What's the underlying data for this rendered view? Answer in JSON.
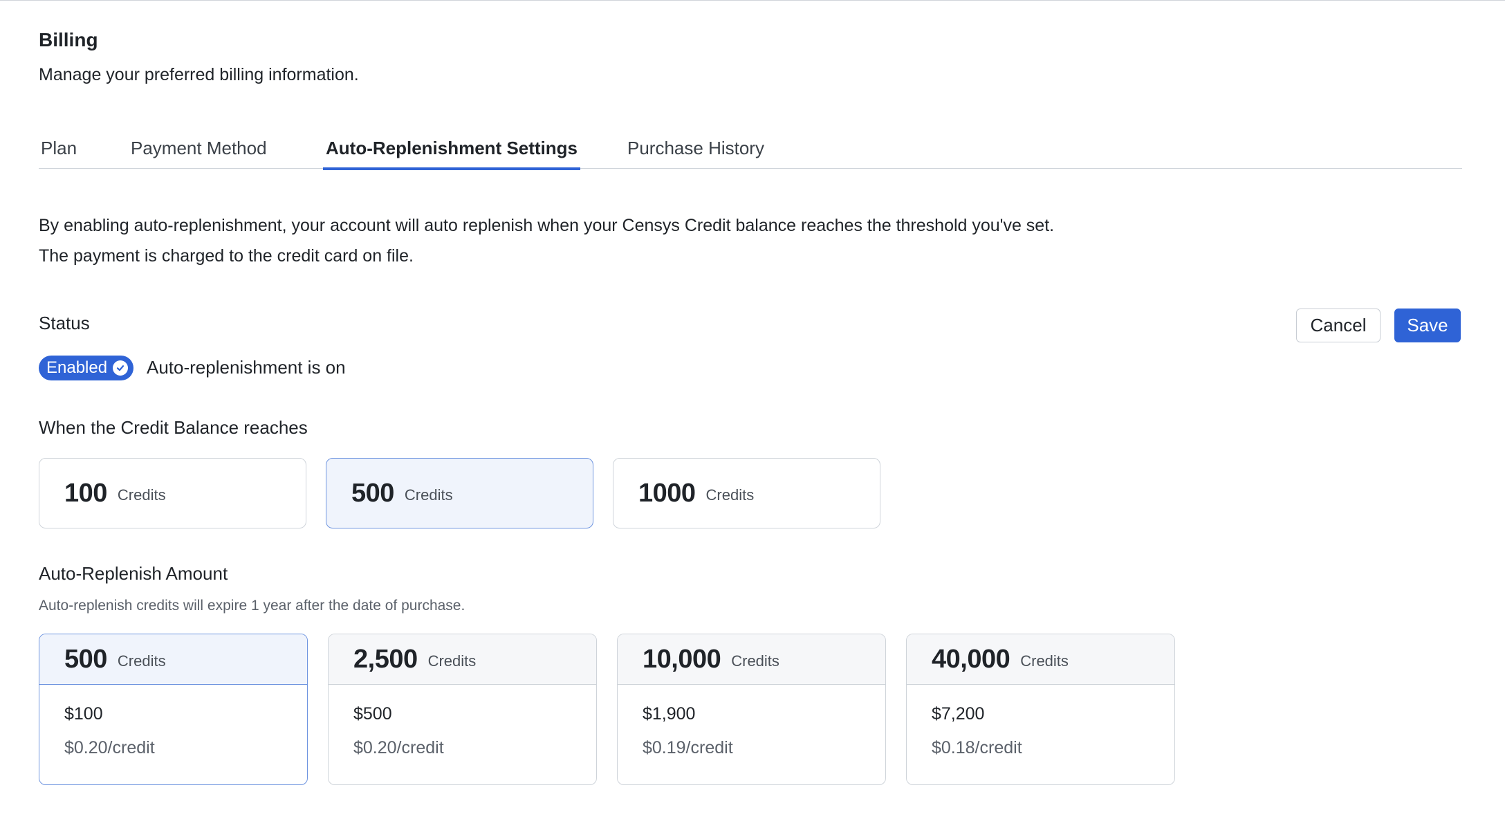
{
  "header": {
    "title": "Billing",
    "subtitle": "Manage your preferred billing information."
  },
  "tabs": [
    {
      "label": "Plan"
    },
    {
      "label": "Payment Method"
    },
    {
      "label": "Auto-Replenishment Settings",
      "active": true
    },
    {
      "label": "Purchase History"
    }
  ],
  "description": {
    "line1": "By enabling auto-replenishment, your account will auto replenish when your Censys Credit balance reaches the threshold you've set.",
    "line2": "The payment is charged to the credit card on file."
  },
  "status": {
    "label": "Status",
    "badge": "Enabled",
    "badge_icon": "check-circle-icon",
    "text": "Auto-replenishment is on"
  },
  "actions": {
    "cancel_label": "Cancel",
    "save_label": "Save"
  },
  "threshold": {
    "label": "When the Credit Balance reaches",
    "selected_index": 1,
    "options": [
      {
        "value": "100",
        "unit": "Credits"
      },
      {
        "value": "500",
        "unit": "Credits"
      },
      {
        "value": "1000",
        "unit": "Credits"
      }
    ]
  },
  "amount": {
    "label": "Auto-Replenish Amount",
    "note": "Auto-replenish credits will expire 1 year after the date of purchase.",
    "selected_index": 0,
    "options": [
      {
        "credits": "500",
        "unit": "Credits",
        "price": "$100",
        "per_credit": "$0.20/credit"
      },
      {
        "credits": "2,500",
        "unit": "Credits",
        "price": "$500",
        "per_credit": "$0.20/credit"
      },
      {
        "credits": "10,000",
        "unit": "Credits",
        "price": "$1,900",
        "per_credit": "$0.19/credit"
      },
      {
        "credits": "40,000",
        "unit": "Credits",
        "price": "$7,200",
        "per_credit": "$0.18/credit"
      }
    ]
  },
  "colors": {
    "accent": "#2f63d6",
    "selected_bg": "#f0f4fc",
    "border": "#cfd4da"
  }
}
